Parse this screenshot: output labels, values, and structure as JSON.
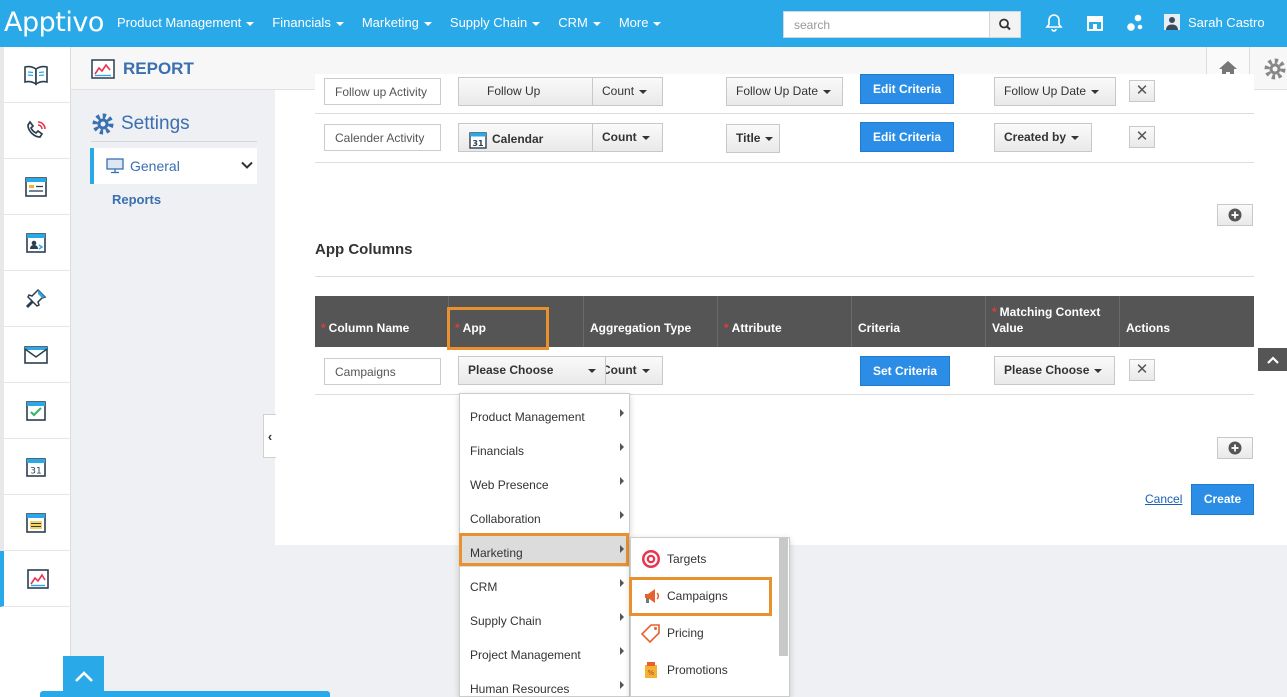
{
  "brand": {
    "logo_text": "Apptivo",
    "accent": "#2aa9e8"
  },
  "topnav": {
    "items": [
      "Product Management",
      "Financials",
      "Marketing",
      "Supply Chain",
      "CRM",
      "More"
    ],
    "search_placeholder": "search",
    "user_name": "Sarah Castro",
    "icons": [
      "search-icon",
      "bell-icon",
      "store-icon",
      "share-icon",
      "user-icon"
    ]
  },
  "iconbar": {
    "icons": [
      "book-icon",
      "phone-icon",
      "form-icon",
      "contact-icon",
      "pin-icon",
      "mail-icon",
      "checklist-icon",
      "calendar-icon",
      "note-icon",
      "report-chart-icon"
    ],
    "active_index": 9
  },
  "header": {
    "title": "REPORT"
  },
  "settings": {
    "title": "Settings",
    "general_label": "General",
    "reports_label": "Reports"
  },
  "activity_rows": [
    {
      "name": "Follow up Activity",
      "app": "Follow Up",
      "aggregation": "Count",
      "attribute": "Follow Up Date",
      "criteria_label": "Edit Criteria",
      "context": "Follow Up Date"
    },
    {
      "name": "Calender Activity",
      "app": "Calendar",
      "aggregation": "Count",
      "attribute": "Title",
      "criteria_label": "Edit Criteria",
      "context": "Created by"
    }
  ],
  "app_columns": {
    "title": "App Columns",
    "headers": [
      "Column Name",
      "App",
      "Aggregation Type",
      "Attribute",
      "Criteria",
      "Matching Context Value",
      "Actions"
    ],
    "required": [
      true,
      true,
      false,
      true,
      false,
      true,
      false
    ],
    "row": {
      "column_name": "Campaigns",
      "app": "Please Choose",
      "aggregation": "Count",
      "criteria_label": "Set Criteria",
      "context": "Please Choose"
    }
  },
  "app_menu": {
    "items": [
      "Product Management",
      "Financials",
      "Web Presence",
      "Collaboration",
      "Marketing",
      "CRM",
      "Supply Chain",
      "Project Management",
      "Human Resources"
    ],
    "active": "Marketing"
  },
  "marketing_submenu": {
    "items": [
      "Targets",
      "Campaigns",
      "Pricing",
      "Promotions"
    ],
    "highlighted": "Campaigns"
  },
  "actions": {
    "cancel": "Cancel",
    "create": "Create"
  }
}
